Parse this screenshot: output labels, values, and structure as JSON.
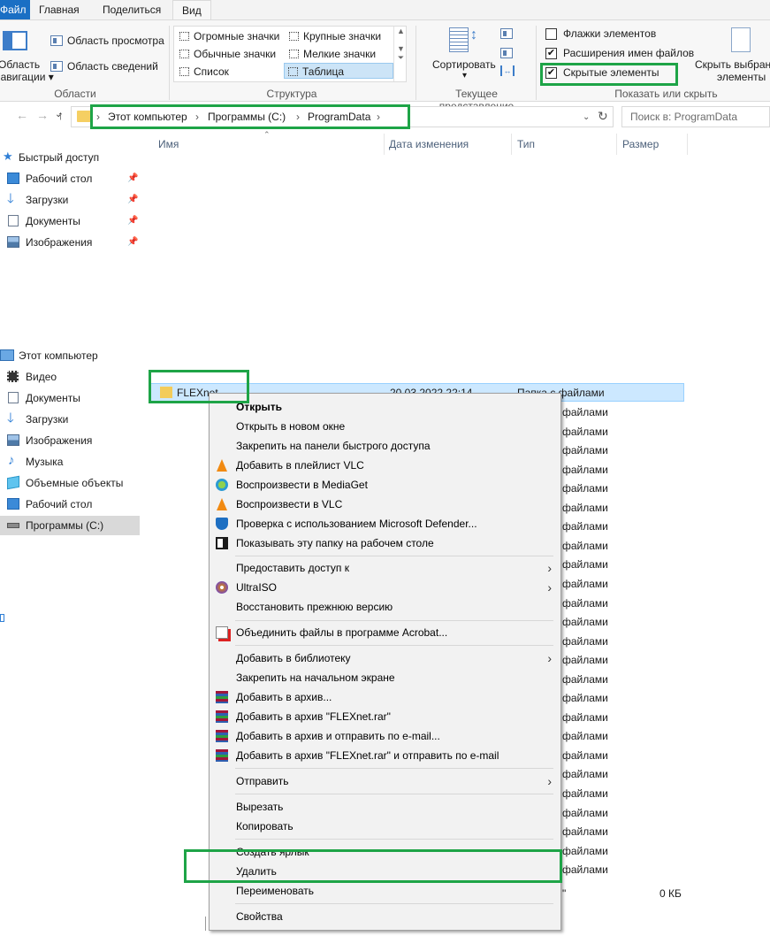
{
  "ribbon": {
    "tabs": [
      "Файл",
      "Главная",
      "Поделиться",
      "Вид"
    ],
    "nav_pane_label_line1": "Область",
    "nav_pane_label_line2": "навигации",
    "preview_pane": "Область просмотра",
    "details_pane": "Область сведений",
    "group_panes": "Области",
    "layouts": [
      "Огромные значки",
      "Крупные значки",
      "Обычные значки",
      "Мелкие значки",
      "Список",
      "Таблица"
    ],
    "group_layout": "Структура",
    "sort_label": "Сортировать",
    "group_current_view": "Текущее представление",
    "checkboxes": [
      {
        "label": "Флажки элементов",
        "checked": false
      },
      {
        "label": "Расширения имен файлов",
        "checked": true
      },
      {
        "label": "Скрытые элементы",
        "checked": true
      }
    ],
    "hide_selected_line1": "Скрыть выбранные",
    "hide_selected_line2": "элементы",
    "group_show_hide": "Показать или скрыть"
  },
  "address": {
    "crumbs": [
      "Этот компьютер",
      "Программы (C:)",
      "ProgramData"
    ],
    "search_placeholder": "Поиск в: ProgramData"
  },
  "columns": [
    "Имя",
    "Дата изменения",
    "Тип",
    "Размер"
  ],
  "nav_quick": [
    {
      "label": "Быстрый доступ"
    },
    {
      "label": "Рабочий стол"
    },
    {
      "label": "Загрузки"
    },
    {
      "label": "Документы"
    },
    {
      "label": "Изображения"
    }
  ],
  "nav_pc": [
    {
      "label": "Этот компьютер"
    },
    {
      "label": "Видео"
    },
    {
      "label": "Документы"
    },
    {
      "label": "Загрузки"
    },
    {
      "label": "Изображения"
    },
    {
      "label": "Музыка"
    },
    {
      "label": "Объемные объекты"
    },
    {
      "label": "Рабочий стол"
    },
    {
      "label": "Программы (C:)"
    }
  ],
  "file": {
    "name": "FLEXnet",
    "date": "20.03.2022 22:14",
    "type": "Папка с файлами"
  },
  "background_rows": {
    "type_text": "файлами",
    "size_text": "0 КБ",
    "partial_name": "\""
  },
  "context_menu": {
    "items": [
      "Открыть",
      "Открыть в новом окне",
      "Закрепить на панели быстрого доступа",
      "Добавить в плейлист VLC",
      "Воспроизвести в MediaGet",
      "Воспроизвести в VLC",
      "Проверка с использованием Microsoft Defender...",
      "Показывать эту папку на рабочем столе",
      "Предоставить доступ к",
      "UltraISO",
      "Восстановить прежнюю версию",
      "Объединить файлы в программе Acrobat...",
      "Добавить в библиотеку",
      "Закрепить на начальном экране",
      "Добавить в архив...",
      "Добавить в архив \"FLEXnet.rar\"",
      "Добавить в архив и отправить по e-mail...",
      "Добавить в архив \"FLEXnet.rar\" и отправить по e-mail",
      "Отправить",
      "Вырезать",
      "Копировать",
      "Создать ярлык",
      "Удалить",
      "Переименовать",
      "Свойства"
    ]
  },
  "colors": {
    "highlight": "#1ea447",
    "selection": "#cce8ff",
    "file_tab": "#1a6fc4"
  }
}
